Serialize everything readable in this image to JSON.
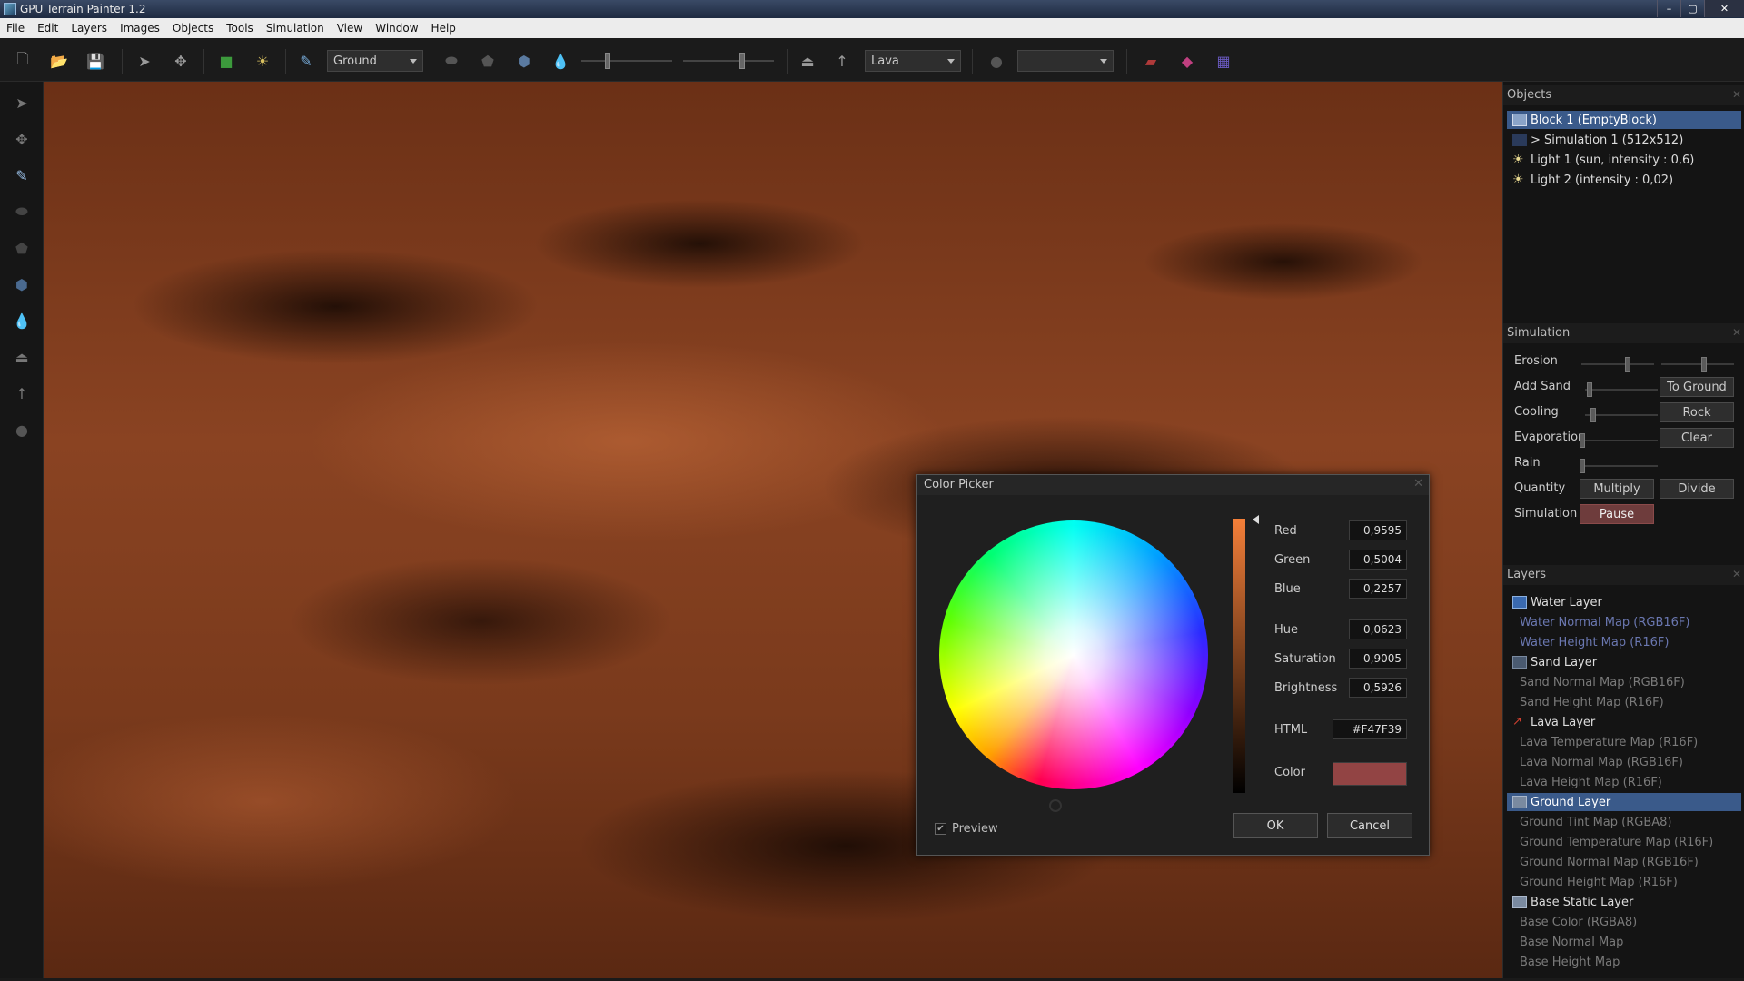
{
  "window": {
    "title": "GPU Terrain Painter 1.2"
  },
  "menu": [
    "File",
    "Edit",
    "Layers",
    "Images",
    "Objects",
    "Tools",
    "Simulation",
    "View",
    "Window",
    "Help"
  ],
  "toolbar": {
    "brush_layer": "Ground",
    "material": "Lava",
    "third_combo": ""
  },
  "objects_panel": {
    "title": "Objects",
    "items": [
      {
        "label": "Block 1 (EmptyBlock)",
        "selected": true
      },
      {
        "label": "> Simulation 1 (512x512)",
        "selected": false
      },
      {
        "label": "Light 1 (sun, intensity : 0,6)",
        "selected": false
      },
      {
        "label": "Light 2 (intensity : 0,02)",
        "selected": false
      }
    ]
  },
  "simulation_panel": {
    "title": "Simulation",
    "erosion": "Erosion",
    "add_sand": "Add Sand",
    "to_ground": "To Ground",
    "cooling": "Cooling",
    "rock": "Rock",
    "evaporation": "Evaporation",
    "clear": "Clear",
    "rain": "Rain",
    "quantity": "Quantity",
    "multiply": "Multiply",
    "divide": "Divide",
    "simulation": "Simulation",
    "pause": "Pause"
  },
  "layers_panel": {
    "title": "Layers",
    "water": {
      "label": "Water Layer",
      "maps": [
        "Water Normal Map (RGB16F)",
        "Water Height Map (R16F)"
      ]
    },
    "sand": {
      "label": "Sand Layer",
      "maps": [
        "Sand Normal Map (RGB16F)",
        "Sand Height Map (R16F)"
      ]
    },
    "lava": {
      "label": "Lava Layer",
      "maps": [
        "Lava Temperature Map (R16F)",
        "Lava Normal Map (RGB16F)",
        "Lava Height Map (R16F)"
      ]
    },
    "ground": {
      "label": "Ground Layer",
      "selected": true,
      "maps": [
        "Ground Tint Map (RGBA8)",
        "Ground Temperature Map (R16F)",
        "Ground Normal Map (RGB16F)",
        "Ground Height Map (R16F)"
      ]
    },
    "base": {
      "label": "Base Static Layer",
      "maps": [
        "Base Color (RGBA8)",
        "Base Normal Map",
        "Base Height Map"
      ]
    }
  },
  "color_picker": {
    "title": "Color Picker",
    "red_label": "Red",
    "red": "0,9595",
    "green_label": "Green",
    "green": "0,5004",
    "blue_label": "Blue",
    "blue": "0,2257",
    "hue_label": "Hue",
    "hue": "0,0623",
    "saturation_label": "Saturation",
    "saturation": "0,9005",
    "brightness_label": "Brightness",
    "brightness": "0,5926",
    "html_label": "HTML",
    "html": "#F47F39",
    "color_label": "Color",
    "swatch_color": "#924444",
    "preview_label": "Preview",
    "preview_checked": true,
    "ok": "OK",
    "cancel": "Cancel"
  },
  "colors": {
    "selection": "#3a5a8a",
    "accent_orange": "#f47f39",
    "pause_button": "#6e3c3c"
  }
}
